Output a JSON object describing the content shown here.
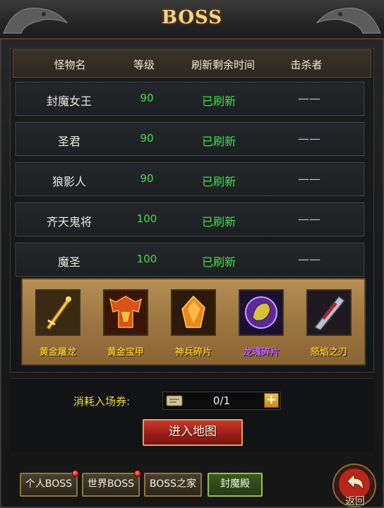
{
  "window": {
    "title": "BOSS"
  },
  "table": {
    "headers": [
      "怪物名",
      "等级",
      "刷新剩余时间",
      "击杀者"
    ],
    "rows": [
      {
        "name": "封魔女王",
        "level": "90",
        "status": "已刷新",
        "killer": "——"
      },
      {
        "name": "圣君",
        "level": "90",
        "status": "已刷新",
        "killer": "——"
      },
      {
        "name": "狼影人",
        "level": "90",
        "status": "已刷新",
        "killer": "——"
      },
      {
        "name": "齐天鬼将",
        "level": "100",
        "status": "已刷新",
        "killer": "——"
      },
      {
        "name": "魔圣",
        "level": "100",
        "status": "已刷新",
        "killer": "——"
      }
    ]
  },
  "rewards": [
    {
      "name": "黄金屠龙",
      "icon": "golden-dragon-sword-icon",
      "color": "#f0c030"
    },
    {
      "name": "黄金宝甲",
      "icon": "golden-armor-icon",
      "color": "#f0c030"
    },
    {
      "name": "神兵碎片",
      "icon": "weapon-fragment-icon",
      "color": "#f0c030"
    },
    {
      "name": "龙魂碎片",
      "icon": "dragon-soul-fragment-icon",
      "color": "#c060ff"
    },
    {
      "name": "怒焰之刃",
      "icon": "flame-blade-icon",
      "color": "#f0c030"
    }
  ],
  "entry": {
    "consume_label": "消耗入场券:",
    "ticket_count": "0/1",
    "plus_label": "+",
    "enter_button": "进入地图"
  },
  "tabs": [
    {
      "label": "个人BOSS",
      "active": false,
      "badge": true
    },
    {
      "label": "世界BOSS",
      "active": false,
      "badge": true
    },
    {
      "label": "BOSS之家",
      "active": false,
      "badge": false
    },
    {
      "label": "封魔殿",
      "active": true,
      "badge": false
    }
  ],
  "return_label": "返回",
  "colors": {
    "title_gold": "#f4d28a",
    "level_green": "#3fe04a",
    "status_green": "#3fe04a",
    "legendary_purple": "#c060ff",
    "consume_yellow": "#f2d94c",
    "enter_red": "#9a1e18"
  }
}
